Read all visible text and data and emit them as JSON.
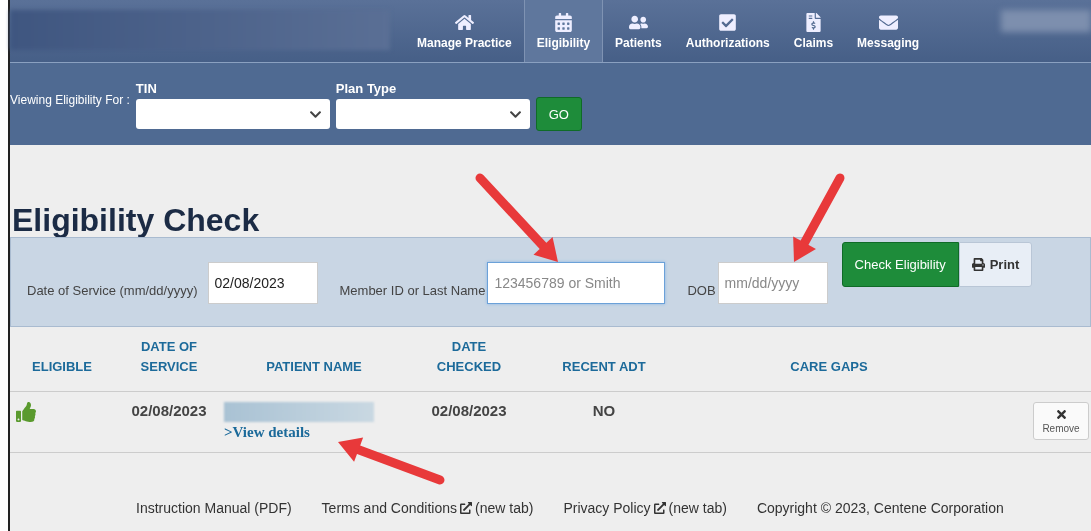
{
  "nav": {
    "items": [
      {
        "label": "Manage Practice",
        "selected": false
      },
      {
        "label": "Eligibility",
        "selected": true
      },
      {
        "label": "Patients",
        "selected": false
      },
      {
        "label": "Authorizations",
        "selected": false
      },
      {
        "label": "Claims",
        "selected": false
      },
      {
        "label": "Messaging",
        "selected": false
      }
    ]
  },
  "filter": {
    "label": "Viewing Eligibility For :",
    "fields": [
      {
        "label": "TIN"
      },
      {
        "label": "Plan Type"
      }
    ],
    "go": "GO"
  },
  "title": "Eligibility Check",
  "search": {
    "fields": [
      {
        "label": "Date of Service (mm/dd/yyyy)",
        "value": "02/08/2023",
        "focused": false
      },
      {
        "label": "Member ID or Last Name",
        "placeholder": "123456789 or Smith",
        "focused": true
      },
      {
        "label": "DOB",
        "placeholder": "mm/dd/yyyy",
        "focused": false
      }
    ],
    "check_button": "Check Eligibility",
    "print_button": "Print"
  },
  "table": {
    "columns": [
      "ELIGIBLE",
      "DATE OF\nSERVICE",
      "PATIENT NAME",
      "DATE\nCHECKED",
      "RECENT ADT",
      "CARE GAPS"
    ],
    "rows": [
      {
        "eligible": true,
        "date_of_service": "02/08/2023",
        "patient_link": ">View details",
        "date_checked": "02/08/2023",
        "recent_adt": "NO",
        "remove": "Remove"
      }
    ]
  },
  "footer": {
    "links": [
      {
        "label": "Instruction Manual (PDF)",
        "external": false
      },
      {
        "label": "Terms and Conditions",
        "external": true,
        "note": "(new tab)"
      },
      {
        "label": "Privacy Policy",
        "external": true,
        "note": "(new tab)"
      }
    ],
    "copyright": "Copyright © 2023, Centene Corporation"
  }
}
